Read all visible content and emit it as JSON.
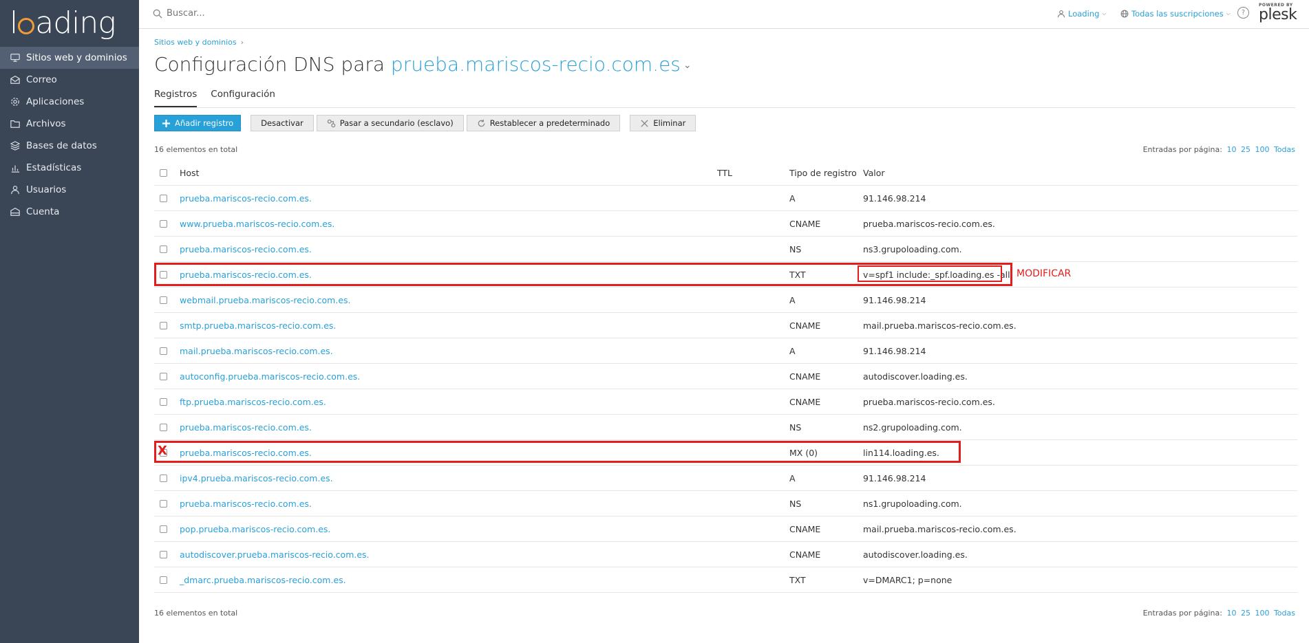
{
  "sidebar": {
    "brand": "loading",
    "items": [
      {
        "label": "Sitios web y dominios",
        "icon": "monitor-icon",
        "active": true
      },
      {
        "label": "Correo",
        "icon": "mail-icon"
      },
      {
        "label": "Aplicaciones",
        "icon": "gear-icon"
      },
      {
        "label": "Archivos",
        "icon": "folder-icon"
      },
      {
        "label": "Bases de datos",
        "icon": "database-icon"
      },
      {
        "label": "Estadísticas",
        "icon": "bar-chart-icon"
      },
      {
        "label": "Usuarios",
        "icon": "user-icon"
      },
      {
        "label": "Cuenta",
        "icon": "account-icon"
      }
    ]
  },
  "topbar": {
    "search_placeholder": "Buscar...",
    "user": "Loading",
    "subscriptions": "Todas las suscripciones",
    "powered_by": "POWERED BY",
    "plesk": "plesk"
  },
  "breadcrumb": "Sitios web y dominios",
  "page": {
    "title_prefix": "Configuración DNS para",
    "domain": "prueba.mariscos-recio.com.es"
  },
  "tabs": [
    "Registros",
    "Configuración"
  ],
  "toolbar": {
    "add": "Añadir registro",
    "disable": "Desactivar",
    "secondary": "Pasar a secundario (esclavo)",
    "reset": "Restablecer a predeterminado",
    "delete": "Eliminar"
  },
  "summary": {
    "total": "16 elementos en total",
    "per_page_label": "Entradas por página:",
    "per_page_options": [
      "10",
      "25",
      "100",
      "Todas"
    ]
  },
  "table": {
    "headers": {
      "host": "Host",
      "ttl": "TTL",
      "type": "Tipo de registro",
      "value": "Valor"
    },
    "rows": [
      {
        "host": "prueba.mariscos-recio.com.es.",
        "ttl": "",
        "type": "A",
        "value": "91.146.98.214"
      },
      {
        "host": "www.prueba.mariscos-recio.com.es.",
        "ttl": "",
        "type": "CNAME",
        "value": "prueba.mariscos-recio.com.es."
      },
      {
        "host": "prueba.mariscos-recio.com.es.",
        "ttl": "",
        "type": "NS",
        "value": "ns3.grupoloading.com."
      },
      {
        "host": "prueba.mariscos-recio.com.es.",
        "ttl": "",
        "type": "TXT",
        "value": "v=spf1 include:_spf.loading.es -all"
      },
      {
        "host": "webmail.prueba.mariscos-recio.com.es.",
        "ttl": "",
        "type": "A",
        "value": "91.146.98.214"
      },
      {
        "host": "smtp.prueba.mariscos-recio.com.es.",
        "ttl": "",
        "type": "CNAME",
        "value": "mail.prueba.mariscos-recio.com.es."
      },
      {
        "host": "mail.prueba.mariscos-recio.com.es.",
        "ttl": "",
        "type": "A",
        "value": "91.146.98.214"
      },
      {
        "host": "autoconfig.prueba.mariscos-recio.com.es.",
        "ttl": "",
        "type": "CNAME",
        "value": "autodiscover.loading.es."
      },
      {
        "host": "ftp.prueba.mariscos-recio.com.es.",
        "ttl": "",
        "type": "CNAME",
        "value": "prueba.mariscos-recio.com.es."
      },
      {
        "host": "prueba.mariscos-recio.com.es.",
        "ttl": "",
        "type": "NS",
        "value": "ns2.grupoloading.com."
      },
      {
        "host": "prueba.mariscos-recio.com.es.",
        "ttl": "",
        "type": "MX (0)",
        "value": "lin114.loading.es."
      },
      {
        "host": "ipv4.prueba.mariscos-recio.com.es.",
        "ttl": "",
        "type": "A",
        "value": "91.146.98.214"
      },
      {
        "host": "prueba.mariscos-recio.com.es.",
        "ttl": "",
        "type": "NS",
        "value": "ns1.grupoloading.com."
      },
      {
        "host": "pop.prueba.mariscos-recio.com.es.",
        "ttl": "",
        "type": "CNAME",
        "value": "mail.prueba.mariscos-recio.com.es."
      },
      {
        "host": "autodiscover.prueba.mariscos-recio.com.es.",
        "ttl": "",
        "type": "CNAME",
        "value": "autodiscover.loading.es."
      },
      {
        "host": "_dmarc.prueba.mariscos-recio.com.es.",
        "ttl": "",
        "type": "TXT",
        "value": "v=DMARC1; p=none"
      }
    ]
  },
  "annotations": {
    "modify_label": "MODIFICAR",
    "delete_mark": "X",
    "color": "#e31c1c"
  }
}
